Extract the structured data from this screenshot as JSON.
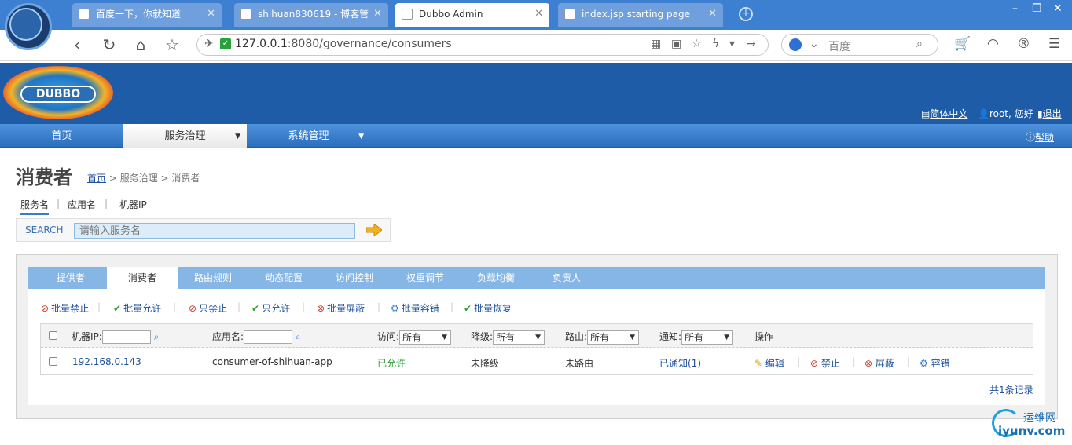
{
  "browser": {
    "tabs": [
      {
        "title": "百度一下，你就知道",
        "active": false
      },
      {
        "title": "shihuan830619 - 博客管",
        "active": false
      },
      {
        "title": "Dubbo Admin",
        "active": true
      },
      {
        "title": "index.jsp starting page",
        "active": false
      }
    ],
    "url_host": "127.0.0.1",
    "url_rest": ":8080/governance/consumers",
    "search_placeholder": "百度"
  },
  "header": {
    "logo_text": "DUBBO",
    "lang_link": "简体中文",
    "user_link": "root, 您好",
    "logout_link": "退出",
    "help_link": "帮助"
  },
  "mainnav": {
    "items": [
      {
        "label": "首页",
        "active": false
      },
      {
        "label": "服务治理",
        "active": true
      },
      {
        "label": "系统管理",
        "active": false
      }
    ]
  },
  "page": {
    "title": "消费者",
    "breadcrumb_home": "首页",
    "breadcrumb_rest": "> 服务治理 > 消费者",
    "search_tabs": [
      "服务名",
      "应用名",
      "机器IP"
    ],
    "search_label": "SEARCH",
    "search_placeholder": "请输入服务名"
  },
  "subtabs": [
    "提供者",
    "消费者",
    "路由规则",
    "动态配置",
    "访问控制",
    "权重调节",
    "负载均衡",
    "负责人"
  ],
  "actions": [
    "批量禁止",
    "批量允许",
    "只禁止",
    "只允许",
    "批量屏蔽",
    "批量容错",
    "批量恢复"
  ],
  "table": {
    "headers": {
      "ip": "机器IP:",
      "app": "应用名:",
      "access": "访问:",
      "degrade": "降级:",
      "route": "路由:",
      "notify": "通知:",
      "ops": "操作",
      "select_all": "所有"
    },
    "rows": [
      {
        "ip": "192.168.0.143",
        "app": "consumer-of-shihuan-app",
        "access": "已允许",
        "degrade": "未降级",
        "route": "未路由",
        "notify": "已通知(1)",
        "op_edit": "编辑",
        "op_forbid": "禁止",
        "op_shield": "屏蔽",
        "op_tolerate": "容错"
      }
    ],
    "total": "共1条记录"
  },
  "watermark": {
    "line1": "运维网",
    "line2": "iyunv.com"
  }
}
